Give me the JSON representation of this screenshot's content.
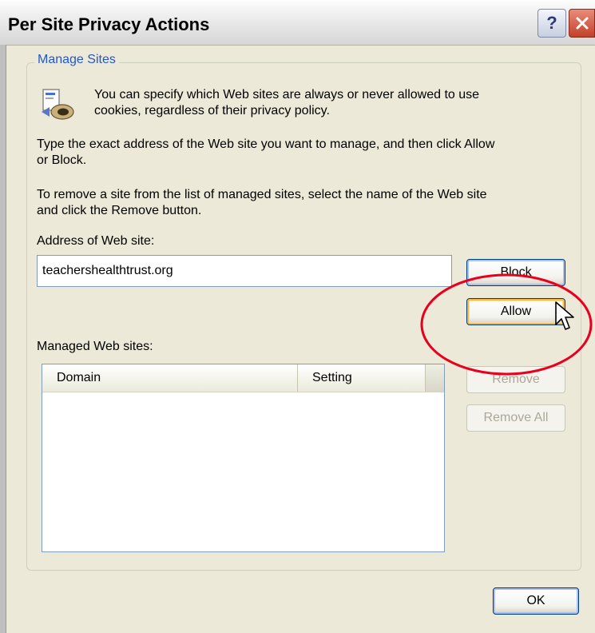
{
  "window": {
    "title": "Per Site Privacy Actions",
    "help_glyph": "?",
    "close_glyph": "✕"
  },
  "group": {
    "legend": "Manage Sites"
  },
  "texts": {
    "intro_line1": "You can specify which Web sites are always or never allowed to use",
    "intro_line2": "cookies, regardless of their privacy policy.",
    "instr1_line1": "Type the exact address of the Web site you want to manage, and then click Allow",
    "instr1_line2": "or Block.",
    "instr2_line1": "To remove a site from the list of managed sites, select the name of the Web site",
    "instr2_line2": "and click the Remove button."
  },
  "address": {
    "label": "Address of Web site:",
    "value": "teachershealthtrust.org"
  },
  "buttons": {
    "block": "Block",
    "allow": "Allow",
    "remove": "Remove",
    "remove_all": "Remove All",
    "ok": "OK"
  },
  "managed": {
    "label": "Managed Web sites:",
    "columns": [
      "Domain",
      "Setting"
    ],
    "rows": []
  },
  "icons": {
    "info": "cookie-privacy-icon",
    "cursor": "mouse-pointer-icon"
  },
  "colors": {
    "legend_text": "#2358c8",
    "annotation_circle": "#e8001c",
    "allow_focus": "#f8b948"
  }
}
